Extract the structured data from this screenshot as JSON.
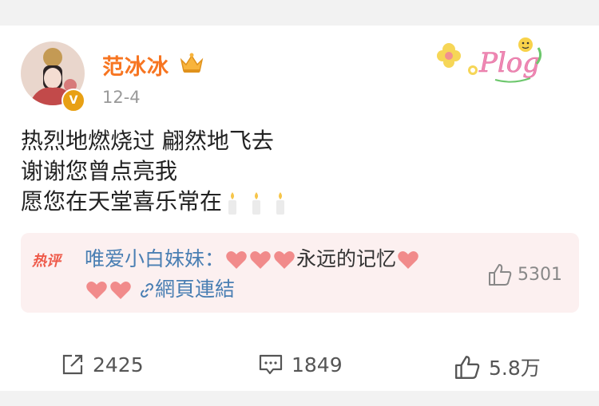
{
  "post": {
    "author": "范冰冰",
    "date": "12-4",
    "lines": [
      "热烈地燃烧过  翩然地飞去",
      "谢谢您曾点亮我",
      "愿您在天堂喜乐常在"
    ],
    "sticker_text": "Plog",
    "emoji": [
      "candle",
      "candle",
      "candle"
    ]
  },
  "hot_comment": {
    "tag": "热评",
    "user": "唯爱小白妹妹：",
    "text": "永远的记忆",
    "link_text": "網頁連結",
    "likes": "5301"
  },
  "actions": {
    "share": "2425",
    "comments": "1849",
    "likes": "5.8万"
  },
  "colors": {
    "name": "#f77521",
    "link": "#4a7fb3",
    "hot_tag": "#ee5a4a",
    "heart": "#f18b8b"
  }
}
